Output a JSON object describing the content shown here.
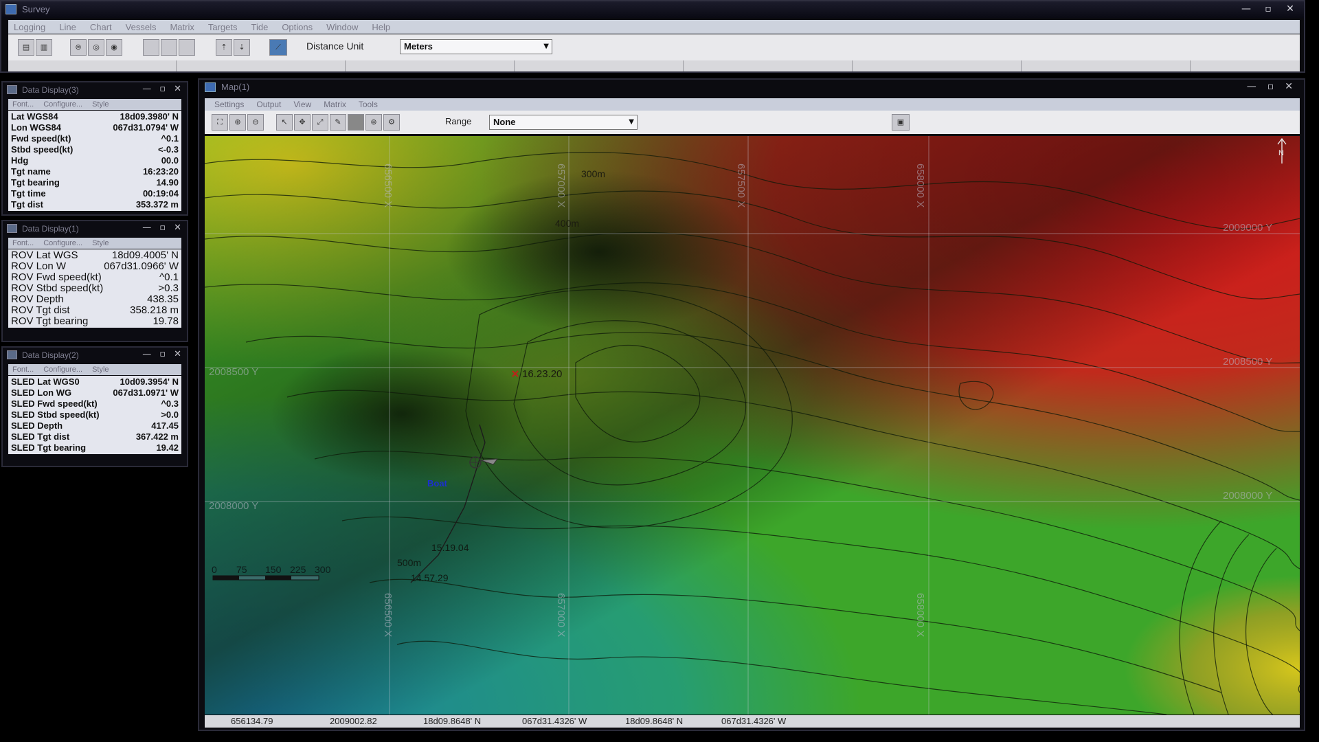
{
  "app": {
    "title": "Survey",
    "menu": [
      "Logging",
      "Line",
      "Chart",
      "Vessels",
      "Matrix",
      "Targets",
      "Tide",
      "Options",
      "Window",
      "Help"
    ],
    "distance_unit_label": "Distance Unit",
    "distance_unit_value": "Meters"
  },
  "panels": {
    "p3": {
      "title": "Data Display(3)",
      "menu": [
        "Font...",
        "Configure...",
        "Style"
      ],
      "rows": [
        {
          "label": "Lat WGS84",
          "value": "18d09.3980' N"
        },
        {
          "label": "Lon WGS84",
          "value": "067d31.0794' W"
        },
        {
          "label": "Fwd speed(kt)",
          "value": "^0.1"
        },
        {
          "label": "Stbd speed(kt)",
          "value": "<-0.3"
        },
        {
          "label": "Hdg",
          "value": "00.0"
        },
        {
          "label": "Tgt name",
          "value": "16:23:20"
        },
        {
          "label": "Tgt bearing",
          "value": "14.90"
        },
        {
          "label": "Tgt time",
          "value": "00:19:04"
        },
        {
          "label": "Tgt dist",
          "value": "353.372 m"
        }
      ]
    },
    "p1": {
      "title": "Data Display(1)",
      "menu": [
        "Font...",
        "Configure...",
        "Style"
      ],
      "rows": [
        {
          "label": "ROV Lat WGS",
          "value": "18d09.4005' N"
        },
        {
          "label": "ROV Lon W",
          "value": "067d31.0966' W"
        },
        {
          "label": "ROV Fwd speed(kt)",
          "value": "^0.1"
        },
        {
          "label": "ROV Stbd speed(kt)",
          "value": ">0.3"
        },
        {
          "label": "ROV Depth",
          "value": "438.35"
        },
        {
          "label": "ROV Tgt dist",
          "value": "358.218 m"
        },
        {
          "label": "ROV Tgt bearing",
          "value": "19.78"
        }
      ]
    },
    "p2": {
      "title": "Data Display(2)",
      "menu": [
        "Font...",
        "Configure...",
        "Style"
      ],
      "rows": [
        {
          "label": "SLED Lat WGS0",
          "value": "10d09.3954' N"
        },
        {
          "label": "SLED Lon WG",
          "value": "067d31.0971' W"
        },
        {
          "label": "SLED Fwd speed(kt)",
          "value": "^0.3"
        },
        {
          "label": "SLED Stbd speed(kt)",
          "value": ">0.0"
        },
        {
          "label": "SLED Depth",
          "value": "417.45"
        },
        {
          "label": "SLED Tgt dist",
          "value": "367.422 m"
        },
        {
          "label": "SLED Tgt bearing",
          "value": "19.42"
        }
      ]
    }
  },
  "map": {
    "title": "Map(1)",
    "menu": [
      "Settings",
      "Output",
      "View",
      "Matrix",
      "Tools"
    ],
    "range_label": "Range",
    "range_value": "None",
    "grid_x_labels": [
      "656500 X",
      "657000 X",
      "657500 X",
      "658000 X"
    ],
    "grid_y_labels": [
      "2009000 Y",
      "2008500 Y",
      "2008000 Y"
    ],
    "contour_labels": [
      "300m",
      "400m",
      "500m"
    ],
    "target_label": "16.23.20",
    "boat_label": "Boat",
    "track_labels": [
      "15.19.04",
      "14.57.29"
    ],
    "scale_ticks": [
      "0",
      "75",
      "150",
      "225",
      "300"
    ],
    "north_label": "N",
    "status": [
      "656134.79",
      "2009002.82",
      "18d09.8648' N",
      "067d31.4326' W",
      "18d09.8648' N",
      "067d31.4326' W"
    ]
  },
  "colors": {
    "deep": "#1f8fa0",
    "mid": "#3fae2a",
    "shallow": "#c8c21a",
    "high": "#d81a14"
  }
}
